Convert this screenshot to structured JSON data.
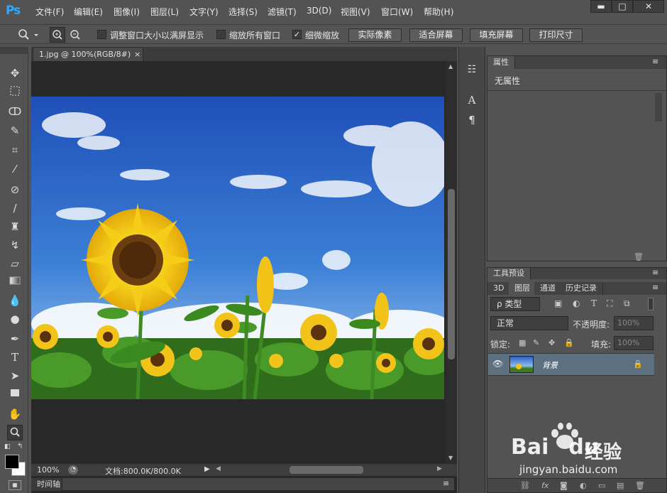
{
  "app": {
    "logo": "Ps"
  },
  "menu": [
    "文件(F)",
    "编辑(E)",
    "图像(I)",
    "图层(L)",
    "文字(Y)",
    "选择(S)",
    "滤镜(T)",
    "3D(D)",
    "视图(V)",
    "窗口(W)",
    "帮助(H)"
  ],
  "window_controls": {
    "minimize": "▬",
    "maximize": "□",
    "close": "✕"
  },
  "options": {
    "checkbox1": {
      "label": "调整窗口大小以满屏显示",
      "checked": false
    },
    "checkbox2": {
      "label": "缩放所有窗口",
      "checked": false
    },
    "checkbox3": {
      "label": "细微缩放",
      "checked": true
    },
    "buttons": [
      "实际像素",
      "适合屏幕",
      "填充屏幕",
      "打印尺寸"
    ]
  },
  "document": {
    "tab_title": "1.jpg @ 100%(RGB/8#)",
    "tab_close": "×",
    "zoom": "100%",
    "doc_info": "文档:800.0K/800.0K"
  },
  "timeline": {
    "label": "时间轴"
  },
  "properties": {
    "tab": "属性",
    "content": "无属性"
  },
  "layers_panel": {
    "tool_presets_tab": "工具预设",
    "tabs": [
      "3D",
      "图层",
      "通道",
      "历史记录"
    ],
    "active_tab": "图层",
    "filter_kind": "ρ 类型",
    "blend_mode": "正常",
    "opacity_label": "不透明度:",
    "opacity_value": "100%",
    "lock_label": "锁定:",
    "fill_label": "填充:",
    "fill_value": "100%",
    "layer_name": "背景"
  },
  "watermark": {
    "brand": "Bai",
    "brand2": "du",
    "cn": "经验",
    "url": "jingyan.baidu.com"
  },
  "colors": {
    "accent": "#31a8ff",
    "panel": "#535353",
    "dark": "#282828",
    "selected_layer": "#5d7080"
  }
}
